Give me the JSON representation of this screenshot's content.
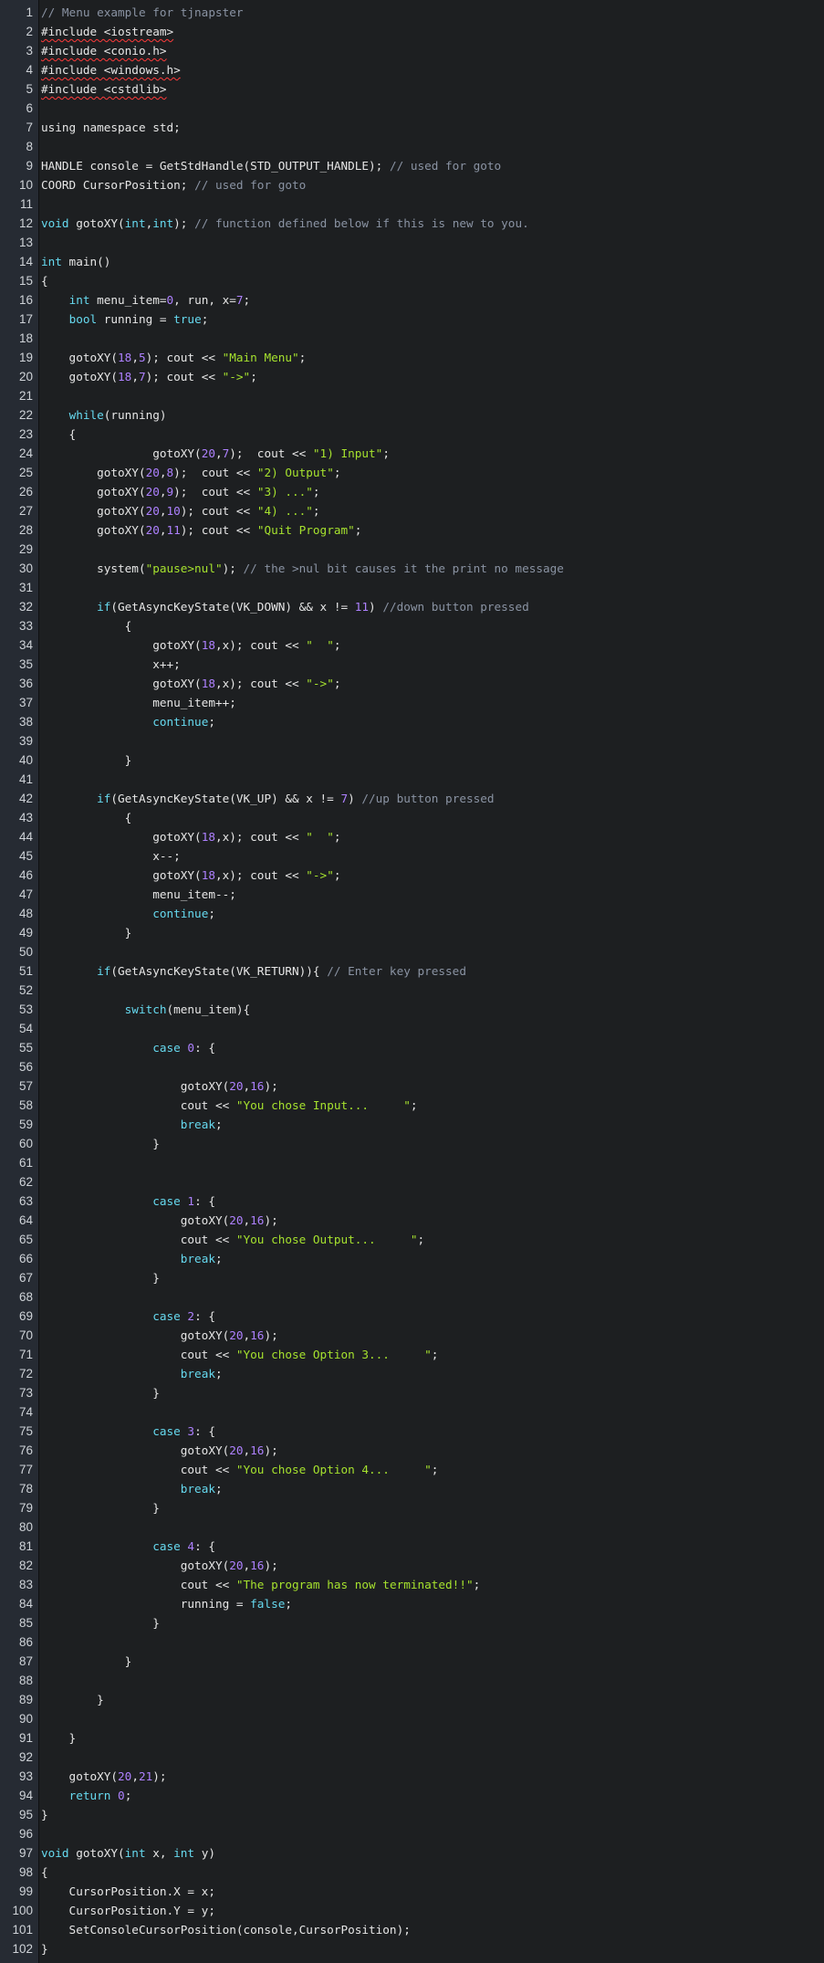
{
  "editor": {
    "lines": [
      "// Menu example for tjnapster",
      "#include <iostream>",
      "#include <conio.h>",
      "#include <windows.h>",
      "#include <cstdlib>",
      "",
      "using namespace std;",
      "",
      "HANDLE console = GetStdHandle(STD_OUTPUT_HANDLE); // used for goto",
      "COORD CursorPosition; // used for goto",
      "",
      "void gotoXY(int,int); // function defined below if this is new to you.",
      "",
      "int main()",
      "{",
      "    int menu_item=0, run, x=7;",
      "    bool running = true;",
      "",
      "    gotoXY(18,5); cout << \"Main Menu\";",
      "    gotoXY(18,7); cout << \"->\";",
      "",
      "    while(running)",
      "    {",
      "                gotoXY(20,7);  cout << \"1) Input\";",
      "        gotoXY(20,8);  cout << \"2) Output\";",
      "        gotoXY(20,9);  cout << \"3) ...\";",
      "        gotoXY(20,10); cout << \"4) ...\";",
      "        gotoXY(20,11); cout << \"Quit Program\";",
      "",
      "        system(\"pause>nul\"); // the >nul bit causes it the print no message",
      "",
      "        if(GetAsyncKeyState(VK_DOWN) && x != 11) //down button pressed",
      "            {",
      "                gotoXY(18,x); cout << \"  \";",
      "                x++;",
      "                gotoXY(18,x); cout << \"->\";",
      "                menu_item++;",
      "                continue;",
      "",
      "            }",
      "",
      "        if(GetAsyncKeyState(VK_UP) && x != 7) //up button pressed",
      "            {",
      "                gotoXY(18,x); cout << \"  \";",
      "                x--;",
      "                gotoXY(18,x); cout << \"->\";",
      "                menu_item--;",
      "                continue;",
      "            }",
      "",
      "        if(GetAsyncKeyState(VK_RETURN)){ // Enter key pressed",
      "",
      "            switch(menu_item){",
      "",
      "                case 0: {",
      "",
      "                    gotoXY(20,16);",
      "                    cout << \"You chose Input...     \";",
      "                    break;",
      "                }",
      "",
      "",
      "                case 1: {",
      "                    gotoXY(20,16);",
      "                    cout << \"You chose Output...     \";",
      "                    break;",
      "                }",
      "",
      "                case 2: {",
      "                    gotoXY(20,16);",
      "                    cout << \"You chose Option 3...     \";",
      "                    break;",
      "                }",
      "",
      "                case 3: {",
      "                    gotoXY(20,16);",
      "                    cout << \"You chose Option 4...     \";",
      "                    break;",
      "                }",
      "",
      "                case 4: {",
      "                    gotoXY(20,16);",
      "                    cout << \"The program has now terminated!!\";",
      "                    running = false;",
      "                }",
      "",
      "            }",
      "",
      "        }",
      "",
      "    }",
      "",
      "    gotoXY(20,21);",
      "    return 0;",
      "}",
      "",
      "void gotoXY(int x, int y)",
      "{",
      "    CursorPosition.X = x;",
      "    CursorPosition.Y = y;",
      "    SetConsoleCursorPosition(console,CursorPosition);",
      "}"
    ],
    "colors": {
      "background": "#1d1f21",
      "gutter": "#262b33",
      "line_number": "#cfd3d8",
      "text": "#e6e6e6",
      "comment": "#8a93a3",
      "keyword": "#66d9ef",
      "string": "#a6e22e",
      "number": "#ae81ff",
      "squiggle": "#ff3b3b"
    },
    "squiggled_lines": [
      2,
      3,
      4,
      5
    ]
  }
}
